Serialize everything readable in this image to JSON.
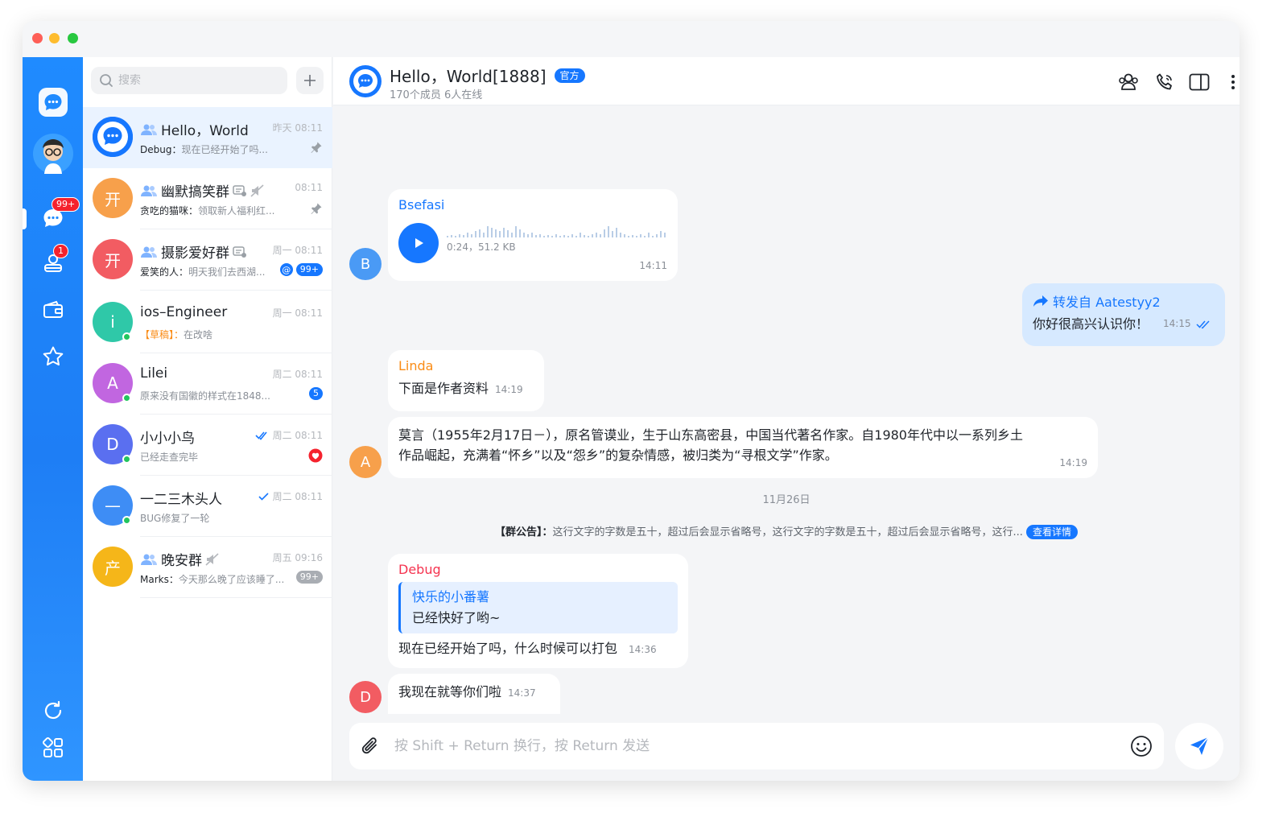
{
  "rail": {
    "chat_badge": "99+",
    "contacts_badge": "1"
  },
  "list": {
    "search_placeholder": "搜索",
    "conversations": [
      {
        "avatar_text": "",
        "avatar_color": "#1677ff",
        "name": "Hello，World",
        "time": "昨天 08:11",
        "sender": "Debug：",
        "preview": "现在已经开始了吗...",
        "group": true
      },
      {
        "avatar_text": "开",
        "avatar_color": "#f7a04b",
        "name": "幽默搞笑群",
        "time": "08:11",
        "sender": "贪吃的猫咪：",
        "preview": "领取新人福利红...",
        "group": true
      },
      {
        "avatar_text": "开",
        "avatar_color": "#f25c62",
        "name": "摄影爱好群",
        "time": "周一 08:11",
        "sender": "爱笑的人：",
        "preview": "明天我们去西湖...",
        "badge": "99+",
        "at": "@",
        "group": true
      },
      {
        "avatar_text": "i",
        "avatar_color": "#2fc8a8",
        "name": "ios–Engineer",
        "time": "周一 08:11",
        "draft": "【草稿】：",
        "preview": "在改啥"
      },
      {
        "avatar_text": "A",
        "avatar_color": "#c166e0",
        "name": "Lilei",
        "time": "周二 08:11",
        "preview": "原来没有国徽的样式在1848...",
        "badge": "5"
      },
      {
        "avatar_text": "D",
        "avatar_color": "#5a6ff0",
        "name": "小小小鸟",
        "time": "周二 08:11",
        "preview": "已经走查完毕"
      },
      {
        "avatar_text": "—",
        "avatar_color": "#3e8df5",
        "name": "一二三木头人",
        "time": "周二 08:11",
        "preview": "BUG修复了一轮"
      },
      {
        "avatar_text": "产",
        "avatar_color": "#f5b619",
        "name": "晚安群",
        "time": "周五 09:16",
        "sender": "Marks：",
        "preview": "今天那么晚了应该睡了...",
        "badge": "99+",
        "group": true
      }
    ]
  },
  "header": {
    "title": "Hello，World[1888]",
    "official_label": "官方",
    "subtitle": "170个成员 6人在线"
  },
  "messages": {
    "voice": {
      "sender": "Bsefasi",
      "meta": "0:24，51.2 KB",
      "time": "14:11",
      "avatar": "B"
    },
    "forward": {
      "label": "转发自 Aatestyy2",
      "text": "你好很高兴认识你！",
      "time": "14:15"
    },
    "linda": {
      "sender": "Linda",
      "text": "下面是作者资料",
      "time": "14:19"
    },
    "long": {
      "avatar": "A",
      "line1": "莫言（1955年2月17日－），原名管谟业，生于山东高密县，中国当代著名作家。自1980年代中以一系列乡土",
      "line2": "作品崛起，充满着“怀乡”以及“怨乡”的复杂情感，被归类为“寻根文学”作家。",
      "time": "14:19"
    },
    "date": "11月26日",
    "notice": {
      "label": "【群公告】：",
      "text": "这行文字的字数是五十，超过后会显示省略号，这行文字的字数是五十，超过后会显示省略号，这行...",
      "detail": "查看详情"
    },
    "debug": {
      "sender": "Debug",
      "quote_name": "快乐的小番薯",
      "quote_text": "已经快好了哟~",
      "text": "现在已经开始了吗，什么时候可以打包",
      "time": "14:36"
    },
    "last": {
      "avatar": "D",
      "text": "我现在就等你们啦",
      "time": "14:37"
    }
  },
  "composer": {
    "placeholder": "按 Shift + Return 换行，按 Return 发送"
  },
  "colors": {
    "accent": "#1677ff",
    "bsefasi": "#1677ff",
    "linda": "#fa8c16",
    "debug": "#f5334f"
  }
}
